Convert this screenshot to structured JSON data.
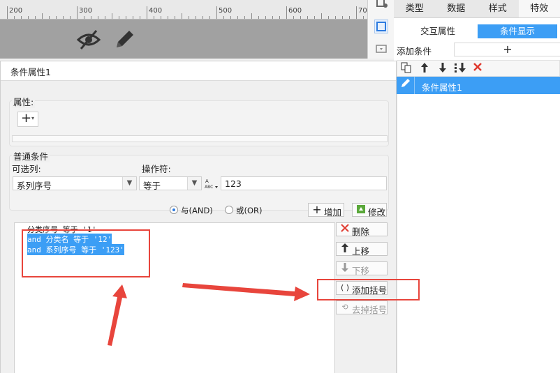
{
  "ruler": {
    "marks": [
      "200",
      "300",
      "400",
      "500",
      "600",
      "700"
    ]
  },
  "canvas": {
    "icons": [
      "eye-slash-icon",
      "pencil-icon"
    ]
  },
  "right_tabs": [
    {
      "label": "类型",
      "active": false
    },
    {
      "label": "数据",
      "active": false
    },
    {
      "label": "样式",
      "active": false
    },
    {
      "label": "特效",
      "active": true
    }
  ],
  "subtabs": [
    {
      "label": "交互属性",
      "active": false
    },
    {
      "label": "条件显示",
      "active": true
    }
  ],
  "add_condition": {
    "label": "添加条件",
    "button": "+"
  },
  "condition_list": {
    "items": [
      "条件属性1"
    ]
  },
  "dialog": {
    "title": "条件属性1",
    "property_group": {
      "title": "属性:",
      "add_button": "+"
    },
    "normal_group": {
      "title": "普通条件",
      "column_label": "可选列:",
      "column_value": "系列序号",
      "operator_label": "操作符:",
      "operator_value": "等于",
      "value": "123"
    },
    "radios": [
      {
        "label": "与(AND)",
        "checked": true
      },
      {
        "label": "或(OR)",
        "checked": false
      }
    ],
    "add_button": "增加",
    "modify_button": "修改",
    "expressions": [
      "分类序号 等于 '1'",
      "and 分类名 等于 '12'",
      "and 系列序号 等于 '123'"
    ],
    "side_buttons": [
      {
        "label": "删除",
        "icon": "x-icon",
        "enabled": true
      },
      {
        "label": "上移",
        "icon": "arrow-up-icon",
        "enabled": true
      },
      {
        "label": "下移",
        "icon": "arrow-down-icon",
        "enabled": false
      },
      {
        "label": "添加括号",
        "icon": "parentheses-icon",
        "enabled": true
      },
      {
        "label": "去掉括号",
        "icon": "remove-parentheses-icon",
        "enabled": false
      }
    ]
  },
  "colors": {
    "accent": "#3c9ef5",
    "annotation": "#e8453c",
    "canvas": "#9e9e9e"
  }
}
